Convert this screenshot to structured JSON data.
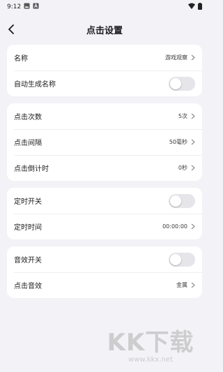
{
  "status_bar": {
    "time": "9:12"
  },
  "nav": {
    "title": "点击设置"
  },
  "card1": {
    "name_label": "名称",
    "name_value": "游戏观察",
    "autogen_label": "自动生成名称",
    "autogen_on": false
  },
  "card2": {
    "count_label": "点击次数",
    "count_value": "5次",
    "interval_label": "点击间隔",
    "interval_value": "50毫秒",
    "countdown_label": "点击倒计时",
    "countdown_value": "0秒"
  },
  "card3": {
    "timer_switch_label": "定时开关",
    "timer_switch_on": false,
    "timer_time_label": "定时时间",
    "timer_time_value": "00:00:00"
  },
  "card4": {
    "sound_switch_label": "音效开关",
    "sound_switch_on": false,
    "sound_label": "点击音效",
    "sound_value": "金属"
  },
  "watermark": {
    "logo": "KK下载",
    "url": "www.kkx.net"
  },
  "colors": {
    "background": "#f2f2f7",
    "card": "#ffffff",
    "toggle_off": "#e5e5ea"
  }
}
